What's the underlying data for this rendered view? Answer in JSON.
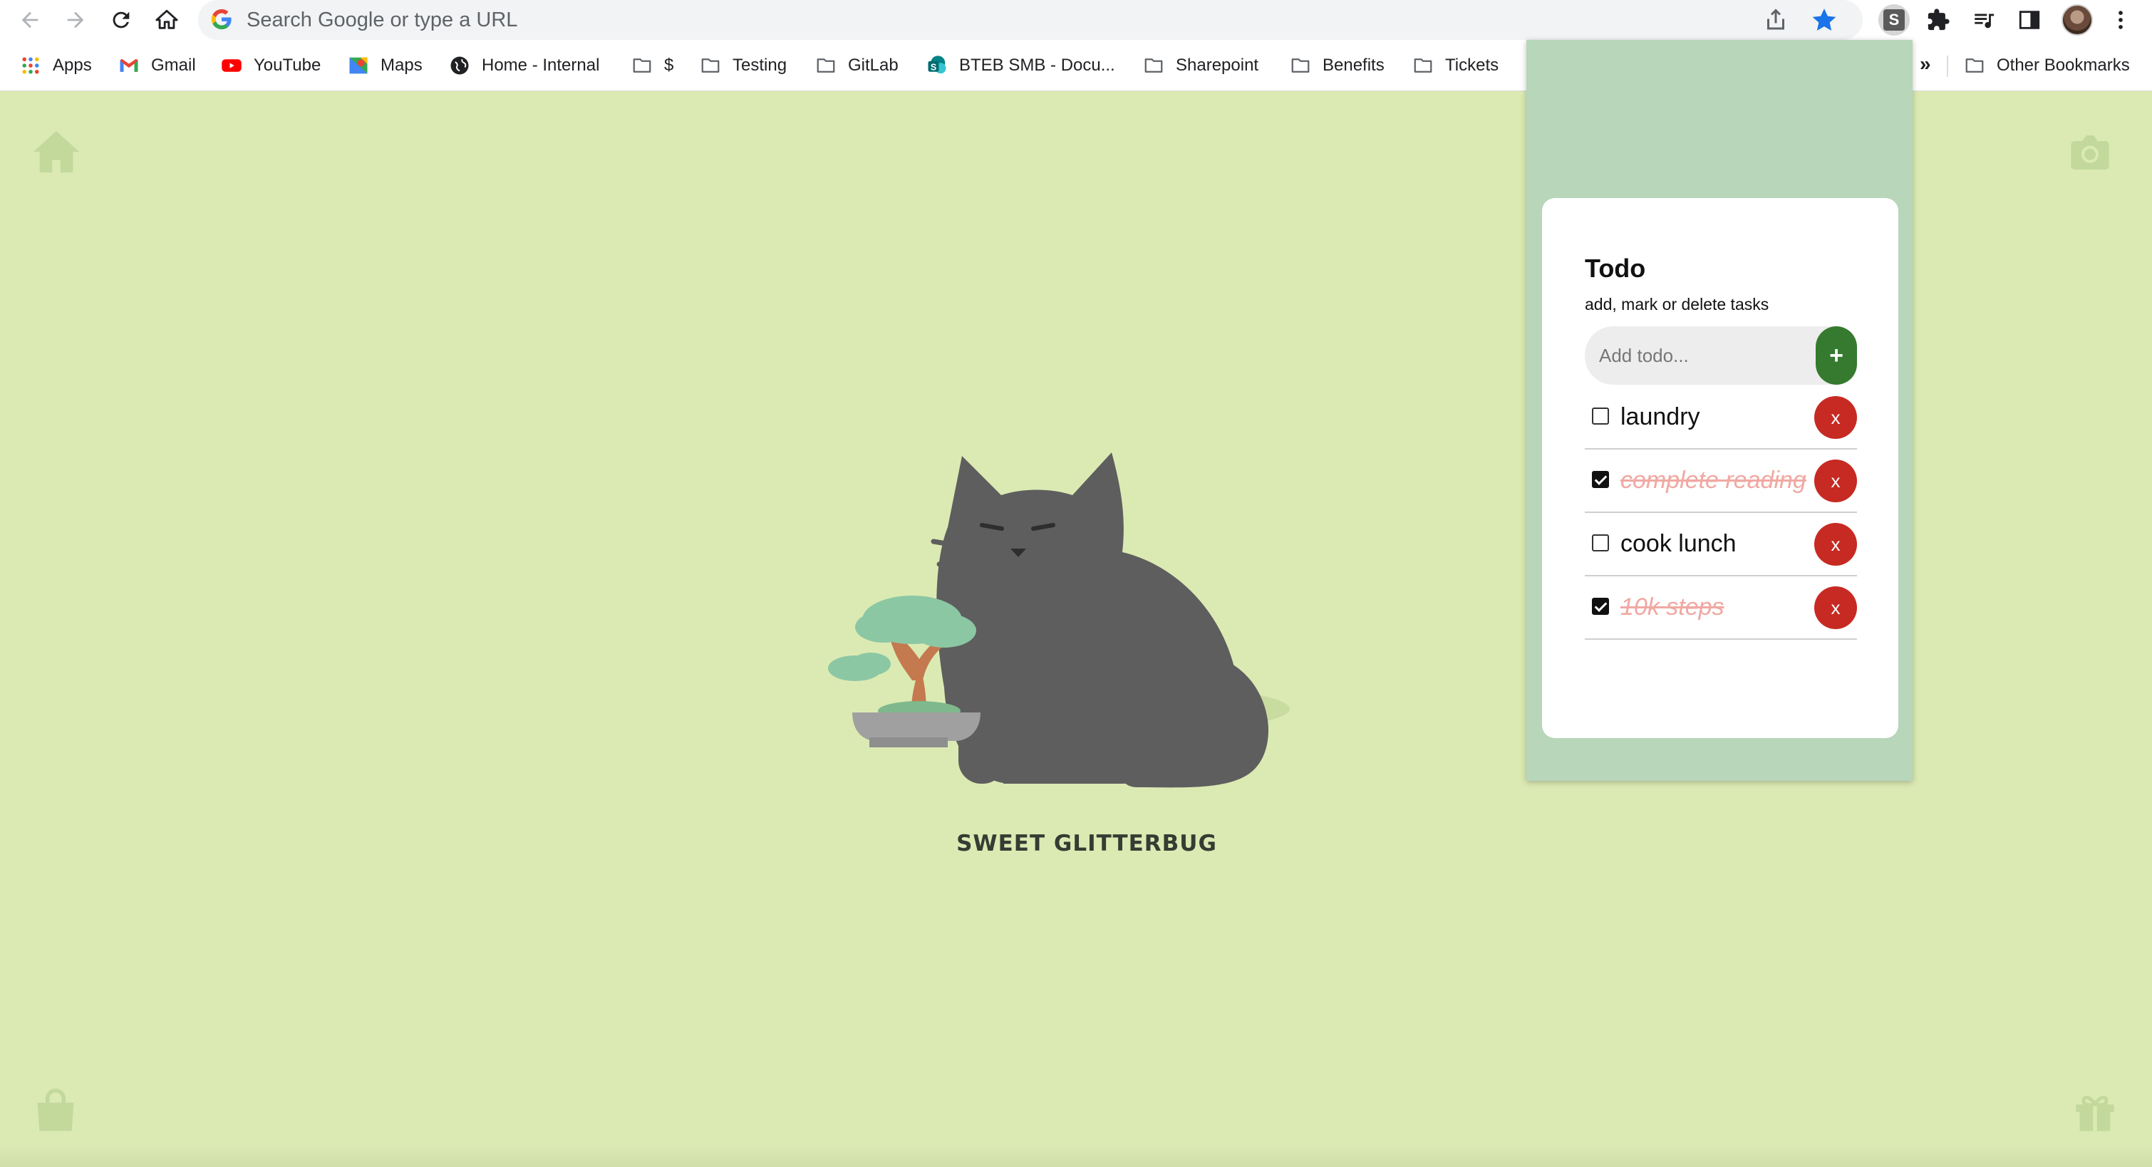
{
  "browser": {
    "url_placeholder": "Search Google or type a URL"
  },
  "bookmarks": [
    {
      "label": "Apps",
      "icon": "apps-grid-icon"
    },
    {
      "label": "Gmail",
      "icon": "gmail-icon"
    },
    {
      "label": "YouTube",
      "icon": "youtube-icon"
    },
    {
      "label": "Maps",
      "icon": "maps-icon"
    },
    {
      "label": "Home - Internal",
      "icon": "globe-icon"
    },
    {
      "label": "$",
      "icon": "folder-icon"
    },
    {
      "label": "Testing",
      "icon": "folder-icon"
    },
    {
      "label": "GitLab",
      "icon": "folder-icon"
    },
    {
      "label": "BTEB SMB - Docu...",
      "icon": "sharepoint-icon"
    },
    {
      "label": "Sharepoint",
      "icon": "folder-icon"
    },
    {
      "label": "Benefits",
      "icon": "folder-icon"
    },
    {
      "label": "Tickets",
      "icon": "folder-icon"
    }
  ],
  "bookmarks_more": "»",
  "other_bookmarks": "Other Bookmarks",
  "extension_s_letter": "S",
  "pet": {
    "name": "SWEET GLITTERBUG"
  },
  "todo": {
    "title": "Todo",
    "subtitle": "add, mark or delete tasks",
    "input_placeholder": "Add todo...",
    "add_label": "+",
    "delete_label": "x",
    "items": [
      {
        "text": "laundry",
        "done": false
      },
      {
        "text": "complete reading",
        "done": true
      },
      {
        "text": "cook lunch",
        "done": false
      },
      {
        "text": "10k steps",
        "done": true
      }
    ]
  },
  "colors": {
    "page_background": "#dbeab3",
    "popup_background": "#b8d6ba",
    "add_button": "#357a2e",
    "delete_button": "#c62a22",
    "done_text": "#f0a9a3",
    "cat": "#5e5e5e"
  }
}
